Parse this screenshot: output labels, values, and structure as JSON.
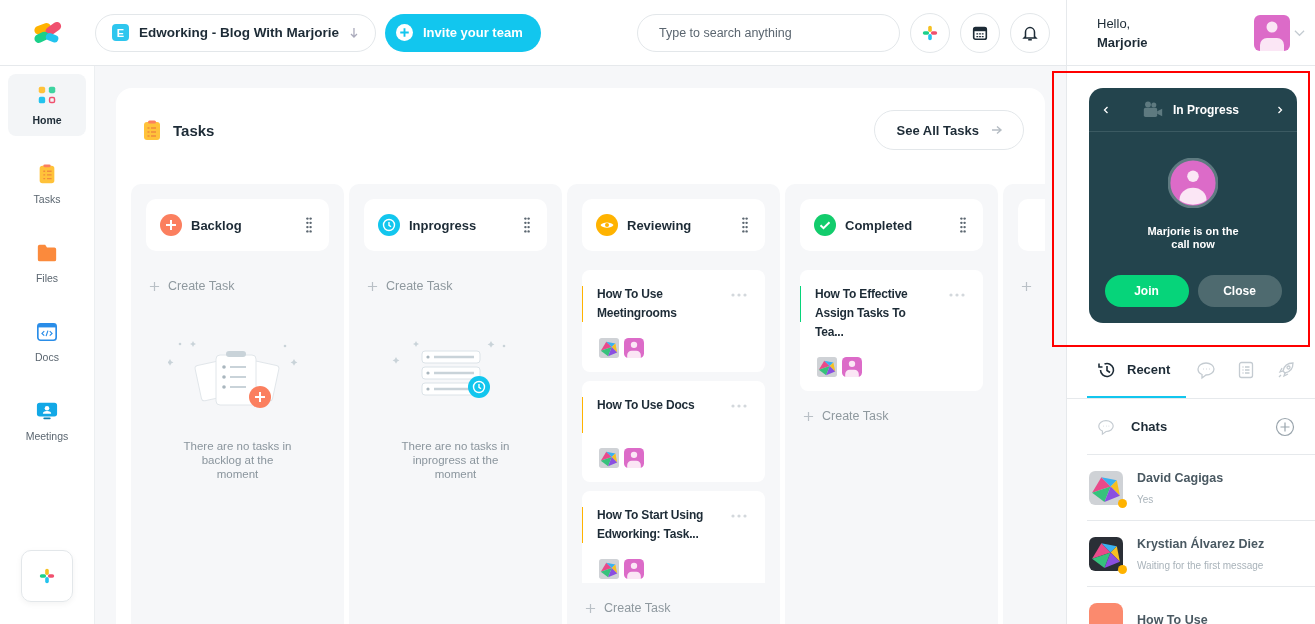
{
  "header": {
    "workspace": {
      "badge": "E",
      "name": "Edworking - Blog With Marjorie"
    },
    "invite_button": "Invite your team",
    "search": {
      "placeholder": "Type to search anything"
    }
  },
  "sidebar": {
    "items": [
      {
        "kind": "home",
        "label": "Home",
        "selected": true
      },
      {
        "kind": "tasks",
        "label": "Tasks",
        "selected": false
      },
      {
        "kind": "files",
        "label": "Files",
        "selected": false
      },
      {
        "kind": "docs",
        "label": "Docs",
        "selected": false
      },
      {
        "kind": "meetings",
        "label": "Meetings",
        "selected": false
      }
    ]
  },
  "tasks": {
    "title": "Tasks",
    "see_all": "See All Tasks",
    "columns": [
      {
        "kind": "backlog",
        "title": "Backlog",
        "create_label": "Create Task",
        "empty_text": "There are no tasks in backlog at the moment"
      },
      {
        "kind": "inprogress",
        "title": "Inprogress",
        "create_label": "Create Task",
        "empty_text": "There are no tasks in inprogress at the moment"
      },
      {
        "kind": "reviewing",
        "title": "Reviewing",
        "create_label": "Create Task",
        "tasks": [
          {
            "title": "How To Use Meetingrooms",
            "color": "#ffb300"
          },
          {
            "title": "How To Use Docs",
            "color": "#ffb300"
          },
          {
            "title": "How To Start Using Edworking: Task...",
            "color": "#ffb300"
          }
        ]
      },
      {
        "kind": "completed",
        "title": "Completed",
        "create_label": "Create Task",
        "tasks": [
          {
            "title": "How To Effective Assign Tasks To Tea...",
            "color": "#06d47a"
          }
        ]
      }
    ]
  },
  "user": {
    "greeting": "Hello,",
    "name": "Marjorie"
  },
  "call": {
    "status": "In Progress",
    "message": "Marjorie is on the call now",
    "join": "Join",
    "close": "Close"
  },
  "panel_tabs": [
    {
      "kind": "recent",
      "label": "Recent",
      "selected": true
    },
    {
      "kind": "chat",
      "selected": false
    },
    {
      "kind": "list",
      "selected": false
    },
    {
      "kind": "rocket",
      "selected": false
    }
  ],
  "chats": {
    "title": "Chats",
    "items": [
      {
        "name": "David Cagigas",
        "message": "Yes",
        "color": "#ffb300"
      },
      {
        "name": "Krystian Álvarez Diez",
        "message": "Waiting for the first message",
        "color": "#ffb300"
      },
      {
        "kind": "tile",
        "name": "How To Use"
      }
    ]
  }
}
